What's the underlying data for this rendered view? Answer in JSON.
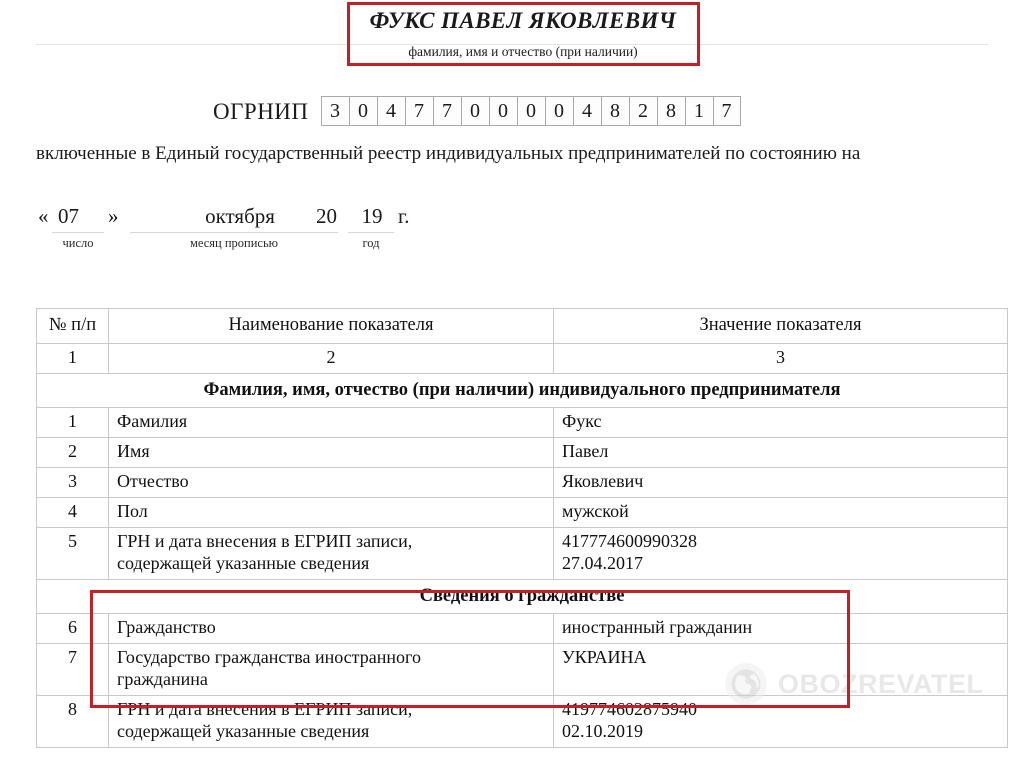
{
  "document": {
    "header": {
      "full_name": "ФУКС ПАВЕЛ ЯКОВЛЕВИЧ",
      "caption": "фамилия, имя и отчество (при наличии)"
    },
    "ogrnip": {
      "label": "ОГРНИП",
      "digits": [
        "3",
        "0",
        "4",
        "7",
        "7",
        "0",
        "0",
        "0",
        "0",
        "4",
        "8",
        "2",
        "8",
        "1",
        "7"
      ]
    },
    "intro_paragraph": "включенные в Единый государственный реестр индивидуальных предпринимателей по состоянию на",
    "date_line": {
      "quote_open": "«",
      "day": "07",
      "quote_close": "»",
      "month": "октября",
      "year_prefix": "20",
      "year_suffix": "19",
      "year_mark": "г.",
      "label_day": "число",
      "label_month": "месяц прописью",
      "label_year": "год"
    },
    "table": {
      "headers": [
        "№ п/п",
        "Наименование показателя",
        "Значение показателя"
      ],
      "column_numbers": [
        "1",
        "2",
        "3"
      ],
      "sections": [
        {
          "title": "Фамилия, имя, отчество (при наличии) индивидуального предпринимателя",
          "rows": [
            {
              "no": "1",
              "name": "Фамилия",
              "value": "Фукс"
            },
            {
              "no": "2",
              "name": "Имя",
              "value": "Павел"
            },
            {
              "no": "3",
              "name": "Отчество",
              "value": "Яковлевич"
            },
            {
              "no": "4",
              "name": "Пол",
              "value": "мужской"
            },
            {
              "no": "5",
              "name": "ГРН и дата внесения в ЕГРИП записи,\nсодержащей указанные сведения",
              "value": "417774600990328\n27.04.2017"
            }
          ]
        },
        {
          "title": "Сведения о гражданстве",
          "rows": [
            {
              "no": "6",
              "name": "Гражданство",
              "value": "иностранный гражданин"
            },
            {
              "no": "7",
              "name": "Государство гражданства иностранного\nгражданина",
              "value": "УКРАИНА"
            },
            {
              "no": "8",
              "name": "ГРН и дата внесения в ЕГРИП записи,\nсодержащей указанные сведения",
              "value": "419774602875940\n02.10.2019"
            }
          ]
        }
      ]
    },
    "watermark": {
      "text": "OBOZREVATEL",
      "icon": "globe-icon"
    },
    "annotations": {
      "highlight_color": "#c22026",
      "highlight_name_box": "name-header",
      "highlight_citizenship_box": "citizenship-section"
    }
  }
}
